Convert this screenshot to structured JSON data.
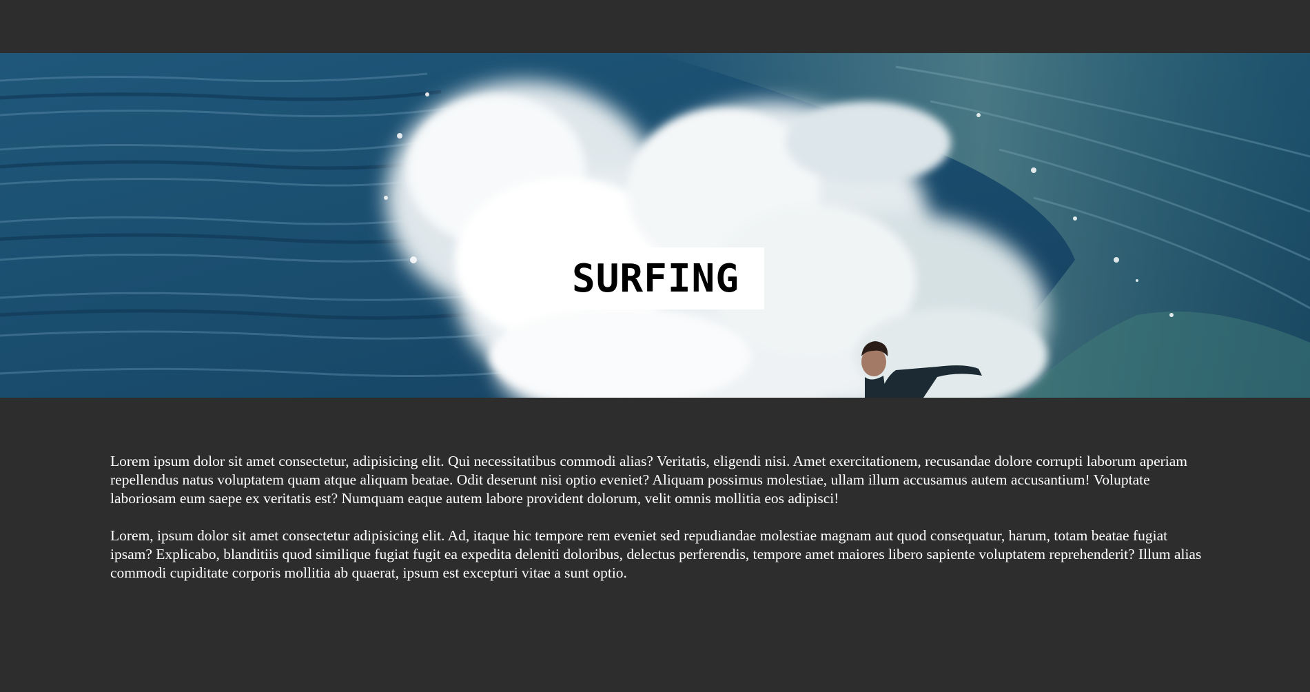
{
  "hero": {
    "title": "SURFING",
    "image": "surfer-riding-breaking-wave-photo"
  },
  "content": {
    "paragraphs": [
      "Lorem ipsum dolor sit amet consectetur, adipisicing elit. Qui necessitatibus commodi alias? Veritatis, eligendi nisi. Amet exercitationem, recusandae dolore corrupti laborum aperiam repellendus natus voluptatem quam atque aliquam beatae. Odit deserunt nisi optio eveniet? Aliquam possimus molestiae, ullam illum accusamus autem accusantium! Voluptate laboriosam eum saepe ex veritatis est? Numquam eaque autem labore provident dolorum, velit omnis mollitia eos adipisci!",
      "Lorem, ipsum dolor sit amet consectetur adipisicing elit. Ad, itaque hic tempore rem eveniet sed repudiandae molestiae magnam aut quod consequatur, harum, totam beatae fugiat ipsam? Explicabo, blanditiis quod similique fugiat fugit ea expedita deleniti doloribus, delectus perferendis, tempore amet maiores libero sapiente voluptatem reprehenderit? Illum alias commodi cupiditate corporis mollitia ab quaerat, ipsum est excepturi vitae a sunt optio."
    ]
  },
  "colors": {
    "page_background": "#2d2d2d",
    "ocean": "#1e4f70",
    "foam": "#f1f3f4",
    "title_box": "#ffffff",
    "text": "#ffffff"
  }
}
